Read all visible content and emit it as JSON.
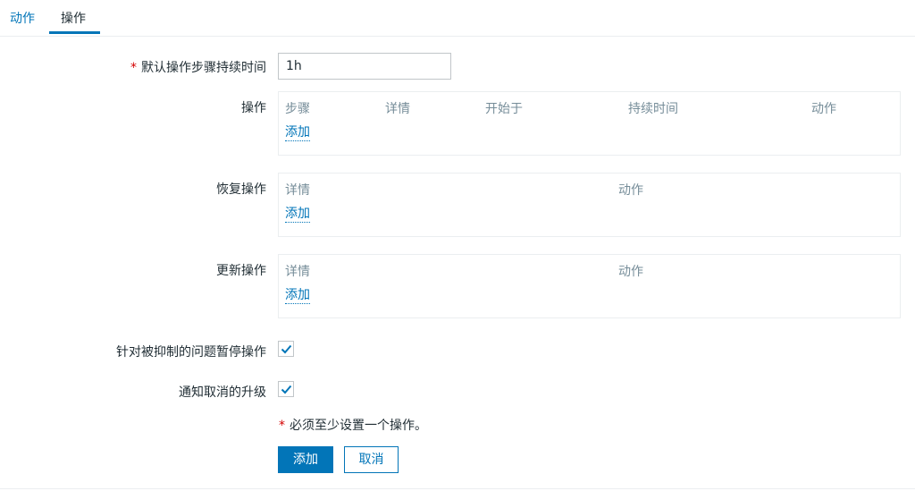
{
  "tabs": [
    {
      "label": "动作",
      "active": false
    },
    {
      "label": "操作",
      "active": true
    }
  ],
  "form": {
    "required_marker": "*",
    "default_duration": {
      "label": "默认操作步骤持续时间",
      "value": "1h"
    },
    "operations": {
      "label": "操作",
      "columns": [
        "步骤",
        "详情",
        "开始于",
        "持续时间",
        "动作"
      ],
      "add_label": "添加"
    },
    "recovery_operations": {
      "label": "恢复操作",
      "columns": [
        "详情",
        "动作"
      ],
      "add_label": "添加"
    },
    "update_operations": {
      "label": "更新操作",
      "columns": [
        "详情",
        "动作"
      ],
      "add_label": "添加"
    },
    "pause_suppressed": {
      "label": "针对被抑制的问题暂停操作",
      "checked": true
    },
    "notify_cancelled": {
      "label": "通知取消的升级",
      "checked": true
    },
    "note": "必须至少设置一个操作。",
    "buttons": {
      "add": "添加",
      "cancel": "取消"
    }
  },
  "colors": {
    "accent": "#0275b8",
    "required": "#d40000",
    "muted_text": "#768d99"
  }
}
